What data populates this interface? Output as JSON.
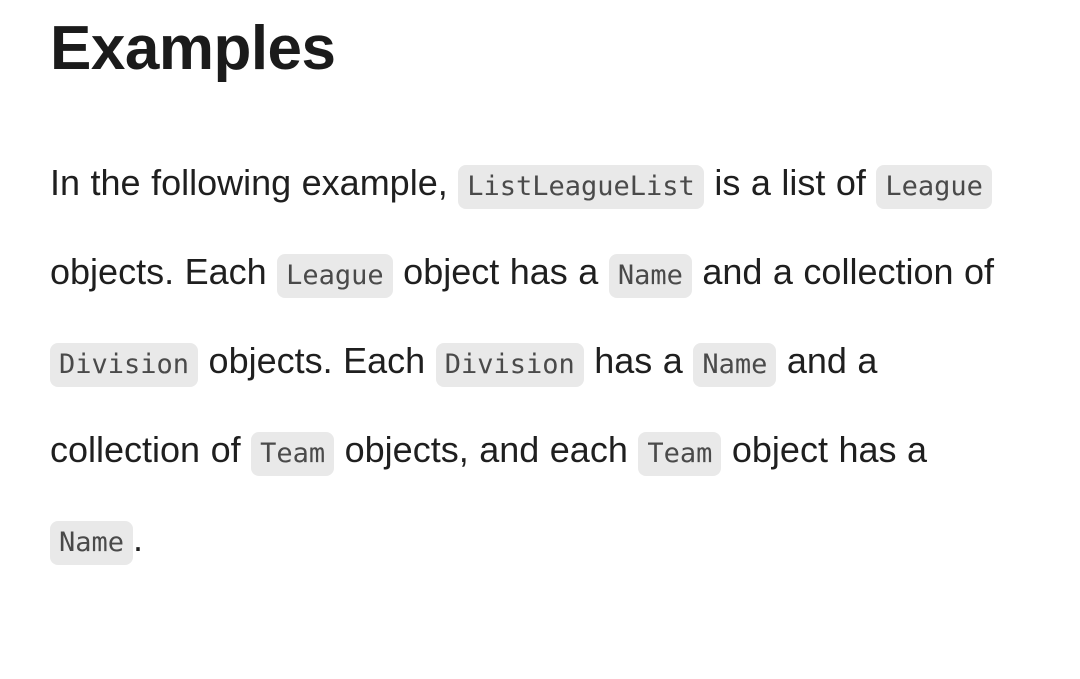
{
  "page": {
    "background_color": "#ffffff",
    "heading": "Examples",
    "heading_color": "#1b1b1b"
  },
  "paragraph": {
    "text_color": "#1f1f1f",
    "code_chip_background": "#e9e9e9",
    "code_chip_text_color": "#4a4a4a",
    "segments": [
      {
        "type": "text",
        "value": "In the following example, "
      },
      {
        "type": "code",
        "value": "ListLeagueList"
      },
      {
        "type": "text",
        "value": " is a list of "
      },
      {
        "type": "code",
        "value": "League"
      },
      {
        "type": "text",
        "value": " objects. Each "
      },
      {
        "type": "code",
        "value": "League"
      },
      {
        "type": "text",
        "value": " object has a "
      },
      {
        "type": "code",
        "value": "Name"
      },
      {
        "type": "text",
        "value": " and a collection of "
      },
      {
        "type": "code",
        "value": "Division"
      },
      {
        "type": "text",
        "value": " objects. Each "
      },
      {
        "type": "code",
        "value": "Division"
      },
      {
        "type": "text",
        "value": " has a "
      },
      {
        "type": "code",
        "value": "Name"
      },
      {
        "type": "text",
        "value": " and a collection of "
      },
      {
        "type": "code",
        "value": "Team"
      },
      {
        "type": "text",
        "value": " objects, and each "
      },
      {
        "type": "code",
        "value": "Team"
      },
      {
        "type": "text",
        "value": " object has a "
      },
      {
        "type": "code",
        "value": "Name"
      },
      {
        "type": "text",
        "value": "."
      }
    ]
  }
}
